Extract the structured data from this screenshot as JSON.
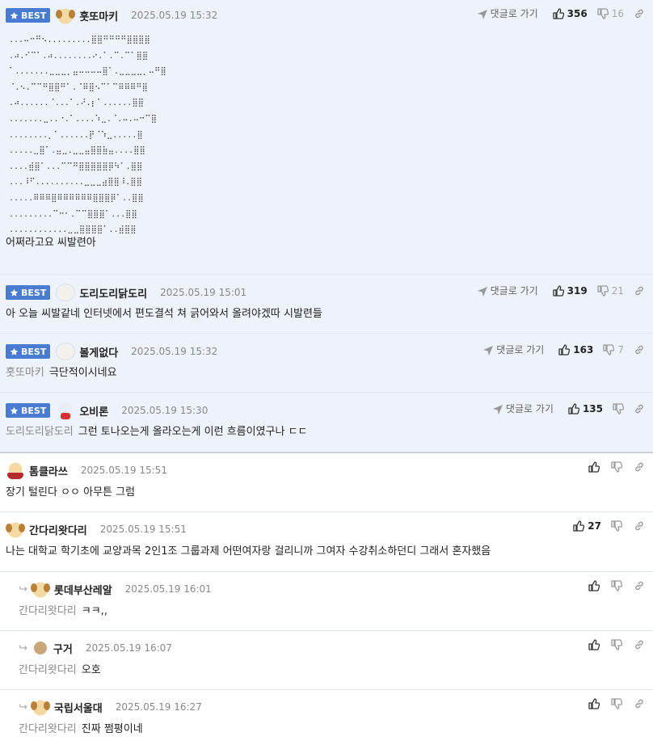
{
  "labels": {
    "best": "BEST",
    "reply_go": "댓글로 가기"
  },
  "colors": {
    "best_badge": "#4a7bd3",
    "best_bg": "#eef2fa"
  },
  "comments": [
    {
      "nick": "훗또마키",
      "date": "2025.05.19 15:32",
      "up": "356",
      "down": "16",
      "ascii_art": [
        "...⠤⠒⠛⠢.........⣿⣿⠛⠛⠛⠛⣿⣿⣿⣿",
        ".⠴.⠊⠉⠁.⠴........⠔.⠁.⠉.⠉⠁⣿⣿",
        "⠁.......⣀⣀⣀⡀⣤⠤⠤⠤⠤⣿⠁.⣀⣀⣀⣀⡀⠤⠛⣿",
        "⠈.⠢.⠉⠉⠛⣿⣿⠛⠁.⠈⠿⣿⠢⠉⠁⠉⠿⠿⠿⠛⣿",
        ".⠴......⠈...⠁.⠜.⡆⠁......⣿⣿",
        ".......⣀..⠐.⠁....⠱⣀.⠈.⠤.⠤⠒⠉⣿",
        "........⡀⠁......⡟⠈⠱⣀.....⣿",
        ".....⣀⣿⠁.⣤⣀.⣀⣀⣤⣿⣿⣷⣤....⣿⣿",
        "....⣾⣿⠁...⠉⠉⠛⣿⣿⣿⣿⣿⡿⠳⠁.⣿⣿",
        "...⠸⠋..........⣀⣀⣀⣴⣿⣿⠸.⣿⣿",
        ".....⠿⠿⠿⣿⠿⠿⠿⠿⠿⠿⣿⣿⣿⡿⠁..⣿⣿",
        ".........⠉⠒⠂.⠉⠉⣿⣿⣿⠁...⣿⣿",
        "............⣀⣀⣿⣿⣿⣿⠁..⣾⣿⣿"
      ],
      "text": "어쩌라고요 씨발련아"
    },
    {
      "nick": "도리도리닭도리",
      "date": "2025.05.19 15:01",
      "up": "319",
      "down": "21",
      "text": "아 오늘 씨발같네 인터넷에서 편도결석 쳐 긁어와서 올려야겠따 시발련들"
    },
    {
      "nick": "볼게없다",
      "date": "2025.05.19 15:32",
      "up": "163",
      "down": "7",
      "ref": "훗또마키",
      "text": "극단적이시네요"
    },
    {
      "nick": "오비론",
      "date": "2025.05.19 15:30",
      "up": "135",
      "ref": "도리도리닭도리",
      "text": "그런 토나오는게 올라오는게 이런 흐름이였구나 ㄷㄷ"
    },
    {
      "nick": "톰클라쓰",
      "date": "2025.05.19 15:51",
      "text": "장기 털린다 ㅇㅇ 아무튼 그럼"
    },
    {
      "nick": "간다리왓다리",
      "date": "2025.05.19 15:51",
      "up": "27",
      "text": "나는 대학교 학기초에 교양과목 2인1조 그룹과제 어떤여자랑 걸리니까 그여자 수강취소하던디 그래서 혼자했음"
    },
    {
      "nick": "롯데부산레알",
      "date": "2025.05.19 16:01",
      "ref": "간다리왓다리",
      "text": "ㅋㅋ,,"
    },
    {
      "nick": "구거",
      "date": "2025.05.19 16:07",
      "ref": "간다리왓다리",
      "text": "오호"
    },
    {
      "nick": "국립서울대",
      "date": "2025.05.19 16:27",
      "ref": "간다리왓다리",
      "text": "진짜 쩜평이네"
    }
  ]
}
